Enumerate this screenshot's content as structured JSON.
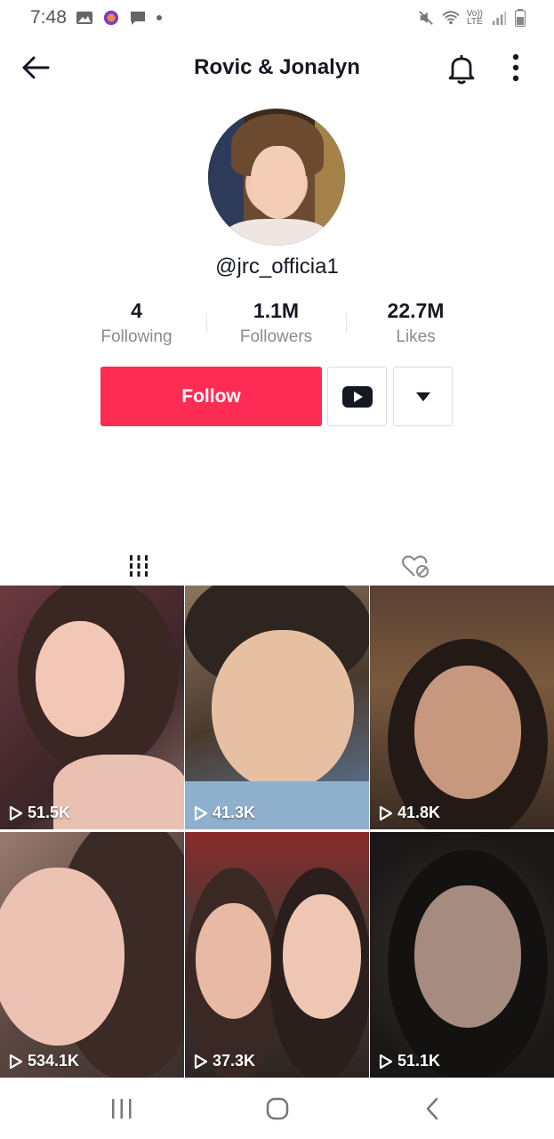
{
  "status_bar": {
    "time": "7:48",
    "icons_left": [
      "gallery-icon",
      "app-notification-icon",
      "message-icon",
      "dot-icon"
    ],
    "icons_right": [
      "mute-icon",
      "wifi-icon",
      "volte-icon",
      "signal-icon",
      "battery-icon"
    ],
    "lte_top": "Vo))",
    "lte_bottom": "LTE"
  },
  "header": {
    "title": "Rovic & Jonalyn"
  },
  "profile": {
    "username": "@jrc_officia1",
    "stats": [
      {
        "value": "4",
        "label": "Following"
      },
      {
        "value": "1.1M",
        "label": "Followers"
      },
      {
        "value": "22.7M",
        "label": "Likes"
      }
    ],
    "follow_label": "Follow"
  },
  "tabs": [
    {
      "name": "videos-tab",
      "icon": "grid-icon",
      "active": true
    },
    {
      "name": "liked-tab",
      "icon": "hidden-heart-icon",
      "active": false
    }
  ],
  "videos": [
    {
      "views": "51.5K"
    },
    {
      "views": "41.3K"
    },
    {
      "views": "41.8K"
    },
    {
      "views": "534.1K"
    },
    {
      "views": "37.3K"
    },
    {
      "views": "51.1K"
    }
  ],
  "colors": {
    "accent": "#fe2c55",
    "text": "#161823",
    "muted": "#8a8b91"
  }
}
